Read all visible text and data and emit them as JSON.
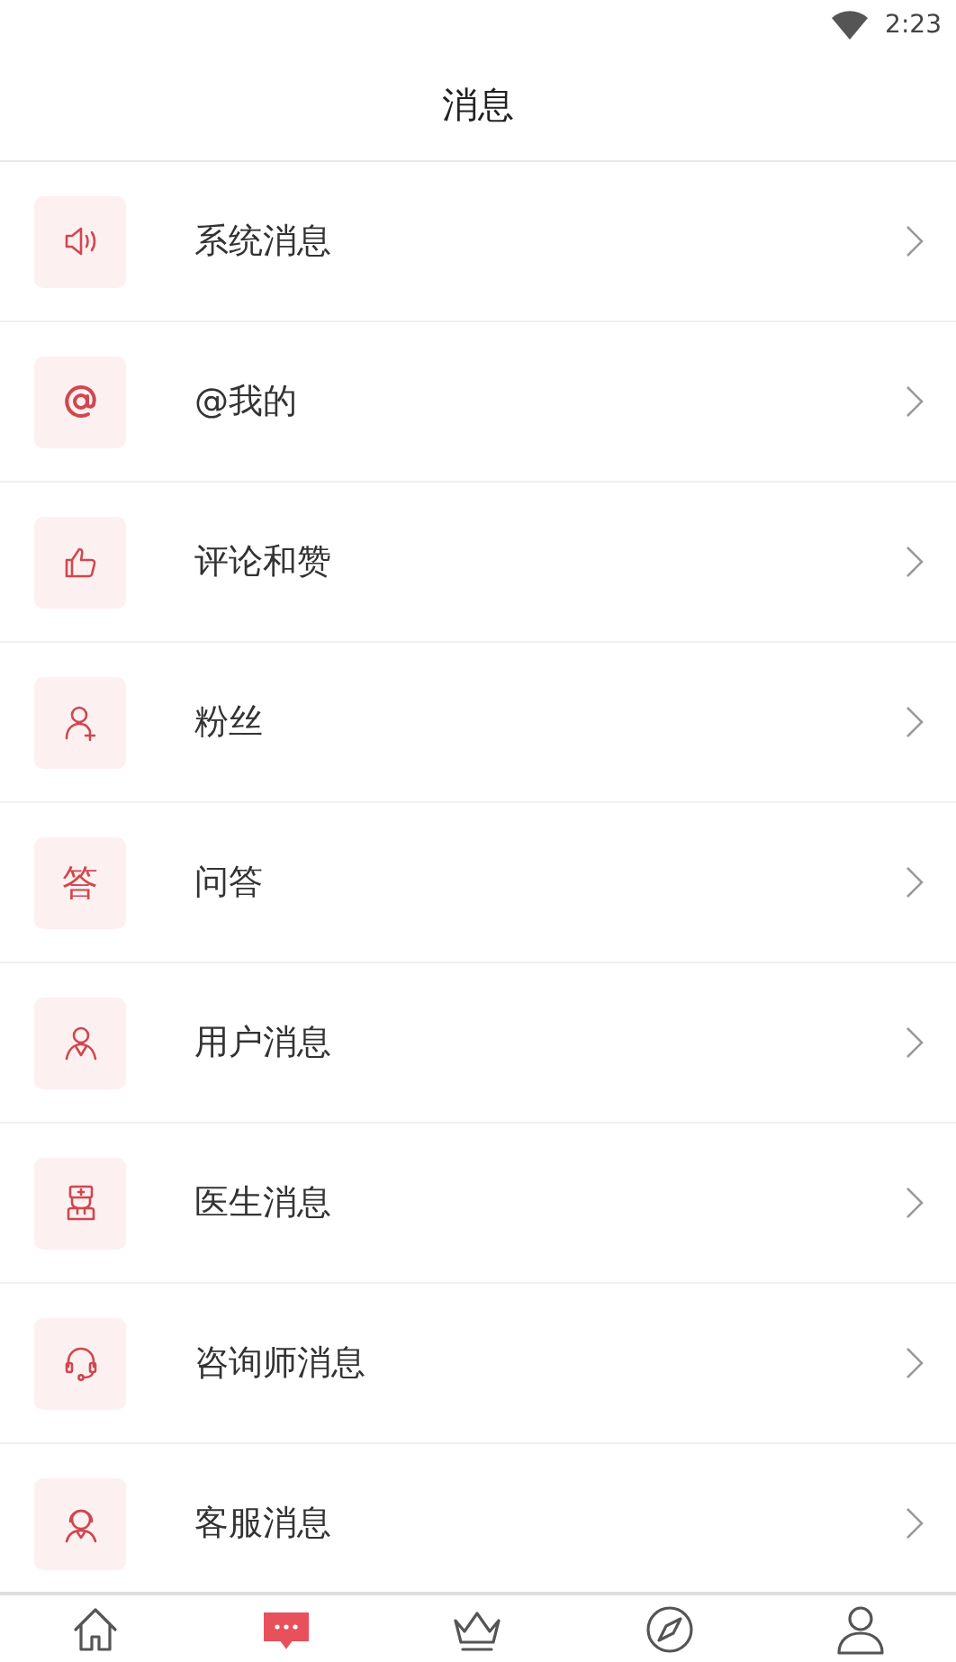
{
  "status_bar": {
    "time": "2:23"
  },
  "header": {
    "title": "消息"
  },
  "items": [
    {
      "kind": "speaker",
      "label": "系统消息"
    },
    {
      "kind": "at",
      "label": "@我的"
    },
    {
      "kind": "thumb",
      "label": "评论和赞"
    },
    {
      "kind": "follower",
      "label": "粉丝"
    },
    {
      "kind": "glyph",
      "glyph": "答",
      "label": "问答"
    },
    {
      "kind": "user",
      "label": "用户消息"
    },
    {
      "kind": "doctor",
      "label": "医生消息"
    },
    {
      "kind": "headset",
      "label": "咨询师消息"
    },
    {
      "kind": "service",
      "label": "客服消息"
    }
  ],
  "nav": [
    {
      "kind": "home",
      "selected": false
    },
    {
      "kind": "chat",
      "selected": true
    },
    {
      "kind": "crown",
      "selected": false
    },
    {
      "kind": "compass",
      "selected": false
    },
    {
      "kind": "person",
      "selected": false
    }
  ]
}
